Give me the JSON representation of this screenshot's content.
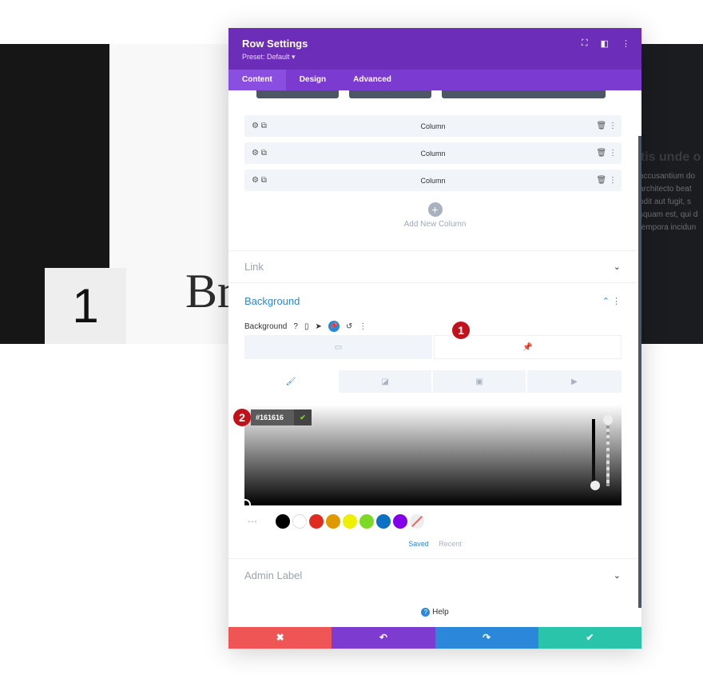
{
  "page": {
    "number": "1",
    "headline": "Br",
    "right_heading": "atis unde o",
    "right_lines": [
      "accusantium do",
      "architecto beat",
      "odit aut fugit, s",
      "squam est, qui d",
      "tempora incidun"
    ]
  },
  "modal": {
    "title": "Row Settings",
    "preset": "Preset: Default ▾",
    "header_icons": [
      "fullscreen-icon",
      "sidebar-icon",
      "more-icon"
    ],
    "tabs": [
      "Content",
      "Design",
      "Advanced"
    ],
    "columns": [
      {
        "label": "Column"
      },
      {
        "label": "Column"
      },
      {
        "label": "Column"
      }
    ],
    "add_column": "Add New Column",
    "link_section": "Link",
    "background": {
      "section": "Background",
      "label": "Background",
      "hex_value": "#161616",
      "swatches": [
        "#000000",
        "#ffffff",
        "#e02b20",
        "#e09900",
        "#edf000",
        "#7cda24",
        "#0c71c3",
        "#8300e9"
      ],
      "saved": "Saved",
      "recent": "Recent",
      "badge_1": "1",
      "badge_2": "2"
    },
    "admin_label": "Admin Label",
    "help": "Help",
    "footer": {
      "cancel": "✖",
      "undo": "↶",
      "redo": "↷",
      "save": "✔"
    },
    "footer_colors": [
      "#ef5555",
      "#7e3bd0",
      "#2b87da",
      "#29c4a9"
    ]
  }
}
